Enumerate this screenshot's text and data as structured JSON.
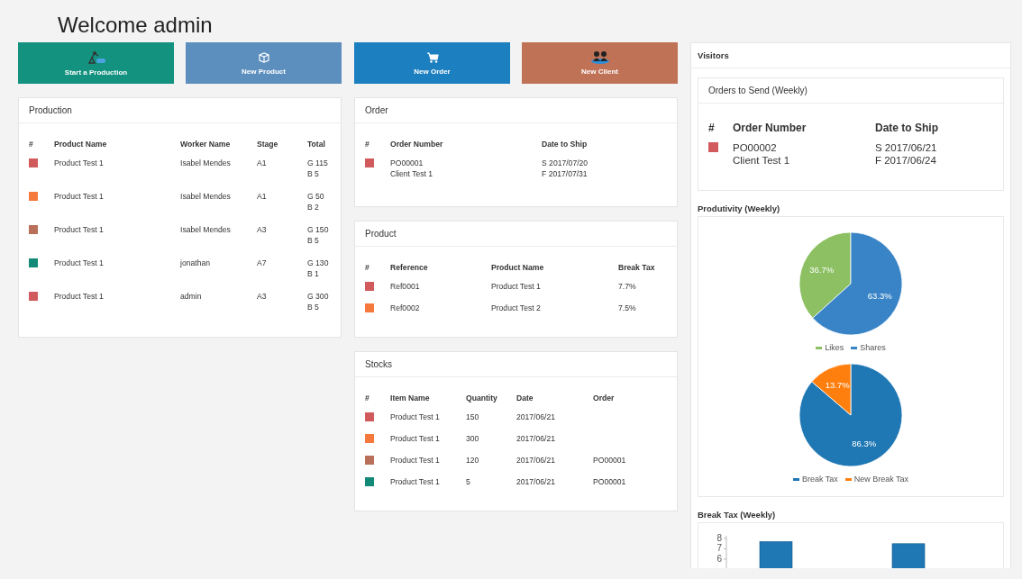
{
  "title": "Welcome admin",
  "actions": [
    {
      "label": "Start a Production",
      "color": "#12927f",
      "kind": "robot"
    },
    {
      "label": "New Product",
      "color": "#5d8fbe",
      "kind": "box"
    },
    {
      "label": "New Order",
      "color": "#1c7fbf",
      "kind": "cart"
    },
    {
      "label": "New Client",
      "color": "#c07257",
      "kind": "users"
    }
  ],
  "production": {
    "title": "Production",
    "columns": [
      "#",
      "Product Name",
      "Worker Name",
      "Stage",
      "Total"
    ],
    "rows": [
      {
        "color": "#d05a5c",
        "cells": [
          "",
          "Product Test 1",
          "Isabel Mendes",
          "A1",
          [
            "G 115",
            "B 5"
          ]
        ]
      },
      {
        "color": "#f5793d",
        "cells": [
          "",
          "Product Test 1",
          "Isabel Mendes",
          "A1",
          [
            "G 50",
            "B 2"
          ]
        ]
      },
      {
        "color": "#b8705a",
        "cells": [
          "",
          "Product Test 1",
          "Isabel Mendes",
          "A3",
          [
            "G 150",
            "B 5"
          ]
        ]
      },
      {
        "color": "#138a78",
        "cells": [
          "",
          "Product Test 1",
          "jonathan",
          "A7",
          [
            "G 130",
            "B 1"
          ]
        ]
      },
      {
        "color": "#d05a5c",
        "cells": [
          "",
          "Product Test 1",
          "admin",
          "A3",
          [
            "G 300",
            "B 5"
          ]
        ]
      }
    ]
  },
  "order": {
    "title": "Order",
    "columns": [
      "#",
      "Order Number",
      "Date to Ship"
    ],
    "rows": [
      {
        "color": "#d05a5c",
        "cells": [
          "",
          [
            "PO00001",
            "Client Test 1"
          ],
          [
            "S 2017/07/20",
            "F 2017/07/31"
          ]
        ]
      }
    ]
  },
  "product": {
    "title": "Product",
    "columns": [
      "#",
      "Reference",
      "Product Name",
      "Break Tax"
    ],
    "rows": [
      {
        "color": "#d05a5c",
        "cells": [
          "",
          "Ref0001",
          "Product Test 1",
          "7.7%"
        ]
      },
      {
        "color": "#f5793d",
        "cells": [
          "",
          "Ref0002",
          "Product Test 2",
          "7.5%"
        ]
      }
    ]
  },
  "stocks": {
    "title": "Stocks",
    "columns": [
      "#",
      "Item Name",
      "Quantity",
      "Date",
      "Order"
    ],
    "rows": [
      {
        "color": "#d05a5c",
        "cells": [
          "",
          "Product Test 1",
          "150",
          "2017/06/21",
          ""
        ]
      },
      {
        "color": "#f5793d",
        "cells": [
          "",
          "Product Test 1",
          "300",
          "2017/06/21",
          ""
        ]
      },
      {
        "color": "#b8705a",
        "cells": [
          "",
          "Product Test 1",
          "120",
          "2017/06/21",
          "PO00001"
        ]
      },
      {
        "color": "#138a78",
        "cells": [
          "",
          "Product Test 1",
          "5",
          "2017/06/21",
          "PO00001"
        ]
      }
    ]
  },
  "visitors": {
    "title": "Visitors",
    "orders_to_send": {
      "title": "Orders to Send (Weekly)",
      "columns": [
        "#",
        "Order Number",
        "Date to Ship"
      ],
      "rows": [
        {
          "color": "#d05a5c",
          "cells": [
            "",
            [
              "PO00002",
              "Client Test 1"
            ],
            [
              "S 2017/06/21",
              "F 2017/06/24"
            ]
          ]
        }
      ]
    },
    "productivity": {
      "title": "Produtivity (Weekly)",
      "pies": [
        {
          "chart_data": {
            "type": "pie",
            "categories": [
              "Likes",
              "Shares"
            ],
            "values": [
              36.7,
              63.3
            ],
            "value_labels": [
              "36.7%",
              "63.3%"
            ],
            "legend": "bottom"
          }
        },
        {
          "chart_data": {
            "type": "pie",
            "categories": [
              "Break Tax",
              "New Break Tax"
            ],
            "values": [
              86.3,
              13.7
            ],
            "value_labels": [
              "86.3%",
              "13.7%"
            ],
            "legend": "bottom"
          }
        }
      ]
    },
    "break_tax": {
      "title": "Break Tax (Weekly)",
      "axis_labels": [
        "8",
        "7",
        "6"
      ]
    }
  }
}
